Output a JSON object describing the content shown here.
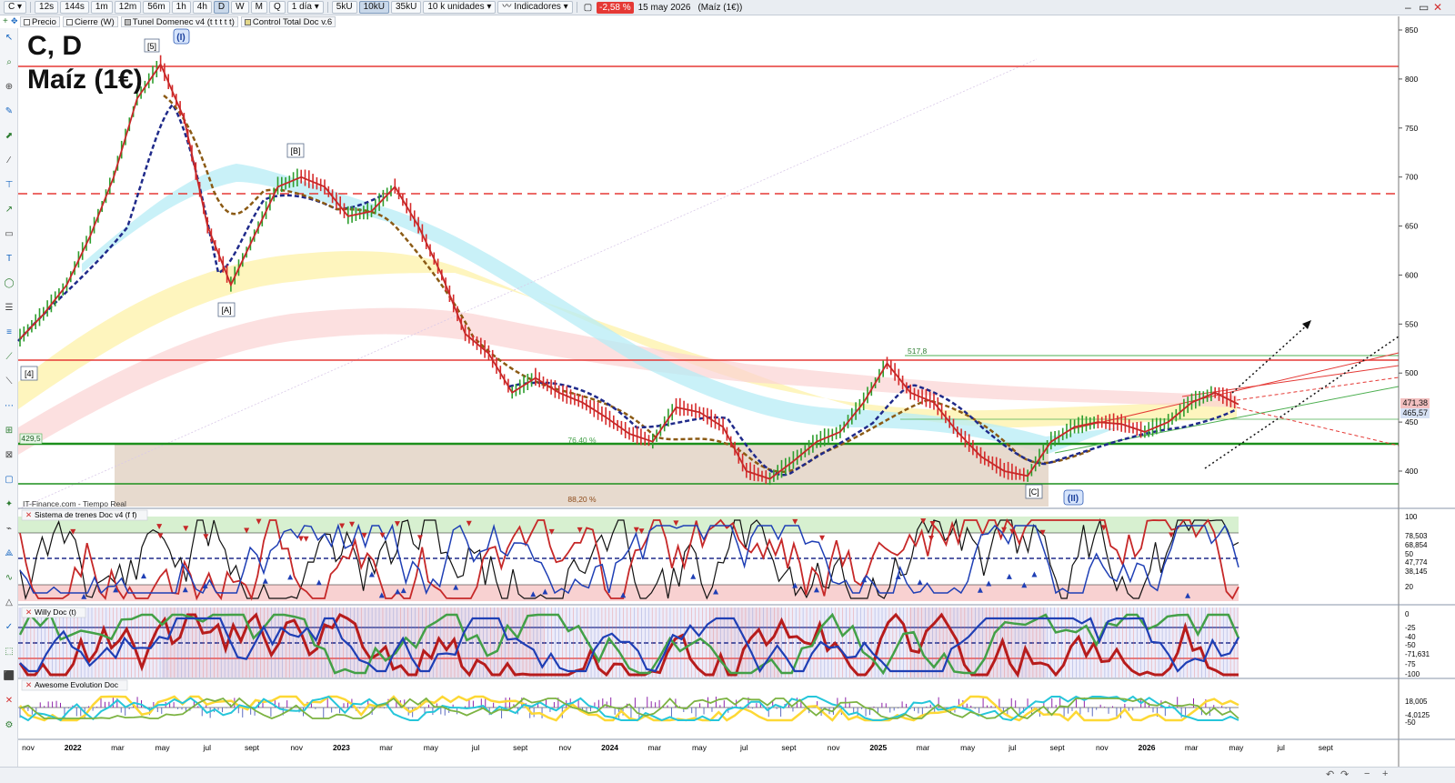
{
  "toolbar": {
    "symbol": "C",
    "timeframes": [
      "12s",
      "144s",
      "1m",
      "12m",
      "56m",
      "1h",
      "4h",
      "D",
      "W",
      "M",
      "Q"
    ],
    "active_timeframe": "D",
    "period": "1 día",
    "unit_options": [
      "5kU",
      "10kU",
      "35kU"
    ],
    "active_unit": "10kU",
    "units_select": "10 k unidades",
    "indicators_label": "Indicadores",
    "change": "-2,58 %",
    "date": "15 may 2026",
    "instrument": "Maíz (1€)"
  },
  "indicators_bar": {
    "items": [
      {
        "label": "Precio",
        "color": "#ffffff"
      },
      {
        "label": "Cierre (W)",
        "color": "#ffffff"
      },
      {
        "label": "Tunel Domenec v4 (t t t t t)",
        "color": "#bbbbbb"
      },
      {
        "label": "Control Total Doc v.6",
        "color": "#e3d78a"
      }
    ]
  },
  "chart": {
    "title_line1": "C, D",
    "title_line2": "Maíz (1€)",
    "watermark": "IT-Finance.com - Tiempo Real",
    "wave_labels": [
      "[5]",
      "(I)",
      "[B]",
      "[A]",
      "[4]",
      "[C]",
      "(II)"
    ],
    "annotations": {
      "level_429": "429,5",
      "level_517": "517,8",
      "fib_76": "76,40 %",
      "fib_88": "88,20 %"
    },
    "price_axis": [
      "850",
      "800",
      "750",
      "700",
      "650",
      "600",
      "550",
      "500",
      "450",
      "400"
    ],
    "price_tags": [
      {
        "text": "471,38",
        "color": "#f3c0c0"
      },
      {
        "text": "465,57",
        "color": "#d7e2f5"
      }
    ],
    "time_axis": [
      "nov",
      "2022",
      "mar",
      "may",
      "jul",
      "sept",
      "nov",
      "2023",
      "mar",
      "may",
      "jul",
      "sept",
      "nov",
      "2024",
      "mar",
      "may",
      "jul",
      "sept",
      "nov",
      "2025",
      "mar",
      "may",
      "jul",
      "sept",
      "nov",
      "2026",
      "mar",
      "may",
      "jul",
      "sept"
    ],
    "price_series": [
      535,
      560,
      590,
      640,
      700,
      780,
      815,
      760,
      650,
      590,
      640,
      690,
      700,
      690,
      660,
      665,
      690,
      650,
      600,
      540,
      520,
      480,
      495,
      480,
      470,
      455,
      438,
      430,
      465,
      460,
      445,
      400,
      392,
      410,
      430,
      440,
      470,
      510,
      480,
      470,
      440,
      415,
      400,
      395,
      430,
      445,
      450,
      448,
      440,
      450,
      470,
      480,
      468
    ]
  },
  "panel_trenes": {
    "title": "Sistema de trenes Doc v4 (f f)",
    "axis": [
      "100",
      "78,503",
      "68,854",
      "50",
      "47,774",
      "38,145",
      "20"
    ]
  },
  "panel_willy": {
    "title": "Willy Doc (t)",
    "axis": [
      "0",
      "-25",
      "-40",
      "-50",
      "-71,631",
      "-75",
      "-100"
    ]
  },
  "panel_awesome": {
    "title": "Awesome Evolution Doc",
    "axis": [
      "18,005",
      "-4,0125",
      "-50"
    ]
  },
  "colors": {
    "resistance": "#e53935",
    "support": "#1b8f1b",
    "avg_dash": "#1f2a8a",
    "avg_brown": "#8b5a14"
  }
}
